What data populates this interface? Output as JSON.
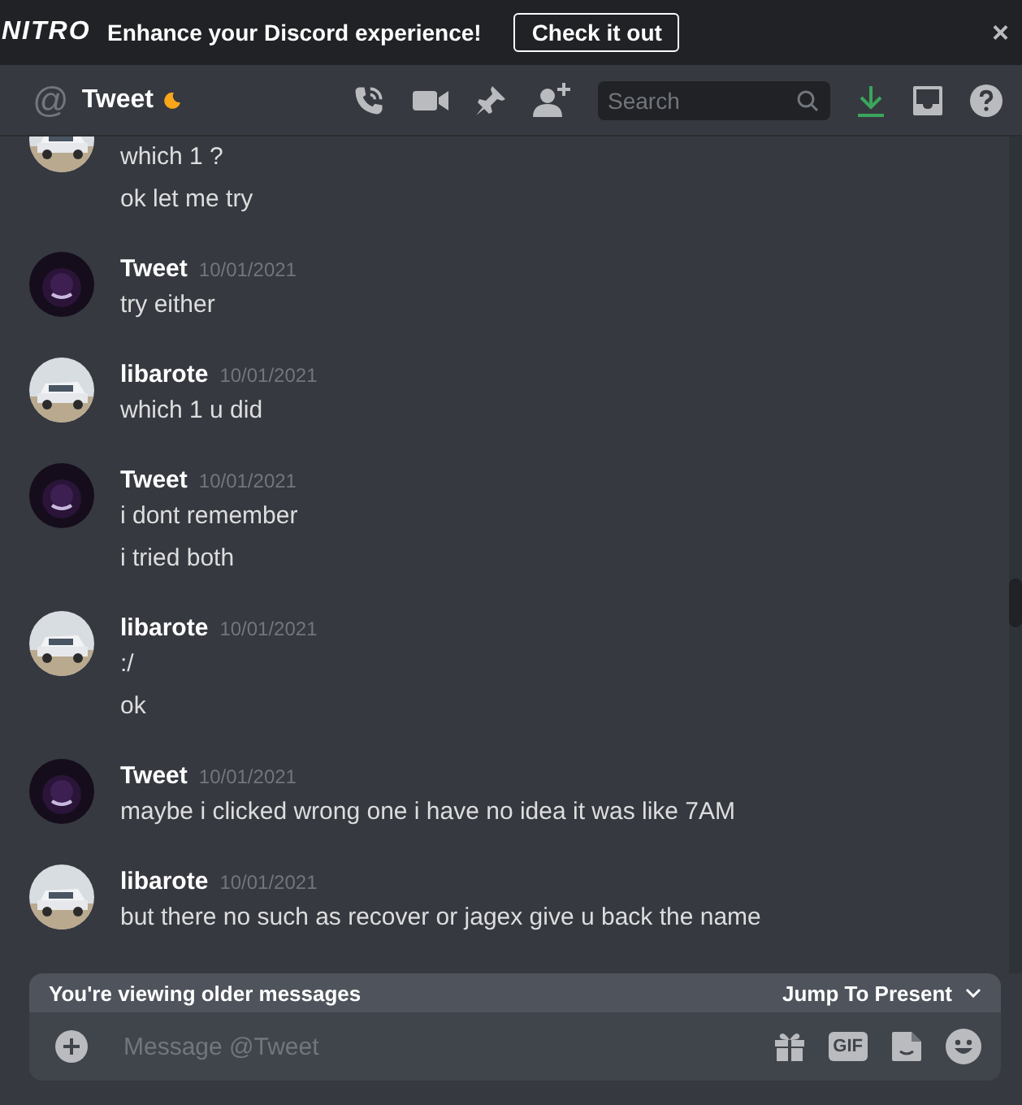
{
  "banner": {
    "logo": "NITRO",
    "text": "Enhance your Discord experience!",
    "button": "Check it out",
    "close": "×"
  },
  "header": {
    "prefix": "@",
    "title": "Tweet",
    "idle": true,
    "search": {
      "placeholder": "Search"
    }
  },
  "messages": [
    {
      "lines": [
        "which 1 ?",
        "ok let me try"
      ]
    },
    {
      "author": "Tweet",
      "time": "10/01/2021",
      "lines": [
        "try either"
      ]
    },
    {
      "author": "libarote",
      "time": "10/01/2021",
      "lines": [
        "which 1 u did"
      ]
    },
    {
      "author": "Tweet",
      "time": "10/01/2021",
      "lines": [
        "i dont remember",
        "i tried both"
      ]
    },
    {
      "author": "libarote",
      "time": "10/01/2021",
      "lines": [
        ":/",
        "ok"
      ]
    },
    {
      "author": "Tweet",
      "time": "10/01/2021",
      "lines": [
        "maybe i clicked wrong one i have no idea it was like 7AM"
      ]
    },
    {
      "author": "libarote",
      "time": "10/01/2021",
      "lines": [
        "but there no such as recover or jagex give u back the name"
      ]
    }
  ],
  "older_bar": {
    "text": "You're viewing older messages",
    "action": "Jump To Present"
  },
  "composer": {
    "placeholder": "Message @Tweet",
    "gif": "GIF"
  }
}
